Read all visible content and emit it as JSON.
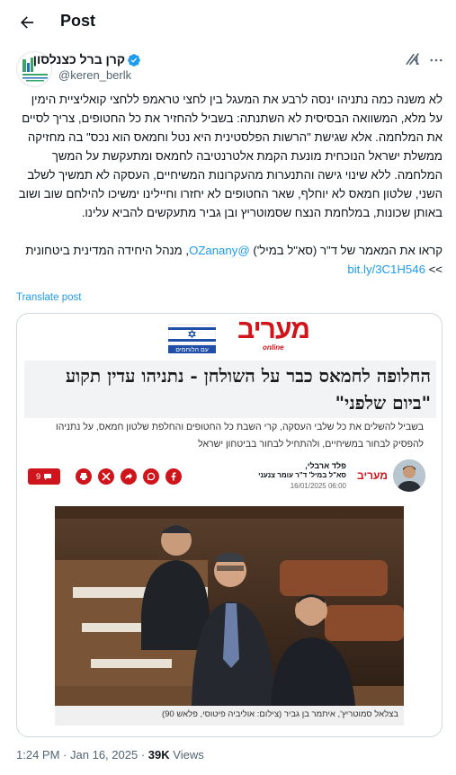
{
  "header": {
    "back_icon": "arrow-left-icon",
    "title": "Post"
  },
  "author": {
    "display_name": "קרן ברל כצנלסון",
    "handle": "@keren_berlk",
    "avatar_text": "קרן ברל כצנלסון",
    "verified_icon": "verified-badge-icon",
    "grok_icon": "grok-icon",
    "more_icon": "more-dots-icon"
  },
  "tweet": {
    "paragraph_1": "לא משנה כמה נתניהו ינסה לרבע את המעגל בין לחצי טראמפ ללחצי קואליציית הימין על מלא, המשוואה הבסיסית לא השתנתה: בשביל להחזיר את כל החטופים, צריך לסיים את המלחמה. אלא שגישת \"הרשות הפלסטינית היא נטל וחמאס הוא נכס\" בה מחזיקה ממשלת ישראל הנוכחית מונעת הקמת אלטרנטיבה לחמאס ומתעקשת על המשך המלחמה. ללא שינוי גישה והתנערות מהעקרונות המשיחיים, העסקה לא תמשיך לשלב השני, שלטון חמאס לא יוחלף, שאר החטופים לא יחזרו וחיילינו ימשיכו להילחם שוב ושוב באותן שכונות, במלחמת הנצח שסמוטריץ ובן גביר מתעקשים להביא עלינו.",
    "p2_prefix": "קראו את המאמר של ד\"ר (סא\"ל במיל') ",
    "p2_mention": "@OZanany",
    "p2_suffix": ", מנהל היחידה המדינית ביטחונית >> ",
    "p2_link": "bit.ly/3C1H546",
    "translate_label": "Translate post"
  },
  "card": {
    "brand": "מעריב",
    "brand_tag": "online",
    "banner_text": "עם הלוחמים",
    "headline": "החלופה לחמאס כבר על השולחן - נתניהו עדין תקוע \"ביום שלפני\"",
    "subhead": "בשביל להשלים את כל שלבי העסקה, קרי השבת כל החטופים והחלפת שלטון חמאס, על נתניהו להפסיק לבחור במשיחיים, ולהתחיל לבחור בביטחון ישראל",
    "article_author": "פלד ארבלי,",
    "article_role": "סא\"ל במיל' ד\"ר עומר צנעני",
    "article_date": "16/01/2025 06:00",
    "author_logo": "מעריב",
    "comment_count": "9",
    "share_icons": [
      "facebook-icon",
      "whatsapp-icon",
      "share-arrow-icon",
      "x-icon",
      "print-icon"
    ],
    "photo_caption": "בצלאל סמוטריץ', איתמר בן גביר (צילום: אוליביה פיטוסי, פלאש 90)"
  },
  "meta": {
    "time": "1:24 PM",
    "separator": "·",
    "date": "Jan 16, 2025",
    "views_count": "39K",
    "views_label": "Views"
  },
  "colors": {
    "accent": "#1d9bf0",
    "brand_red": "#d0141b",
    "text": "#0f1419",
    "muted": "#536471"
  }
}
